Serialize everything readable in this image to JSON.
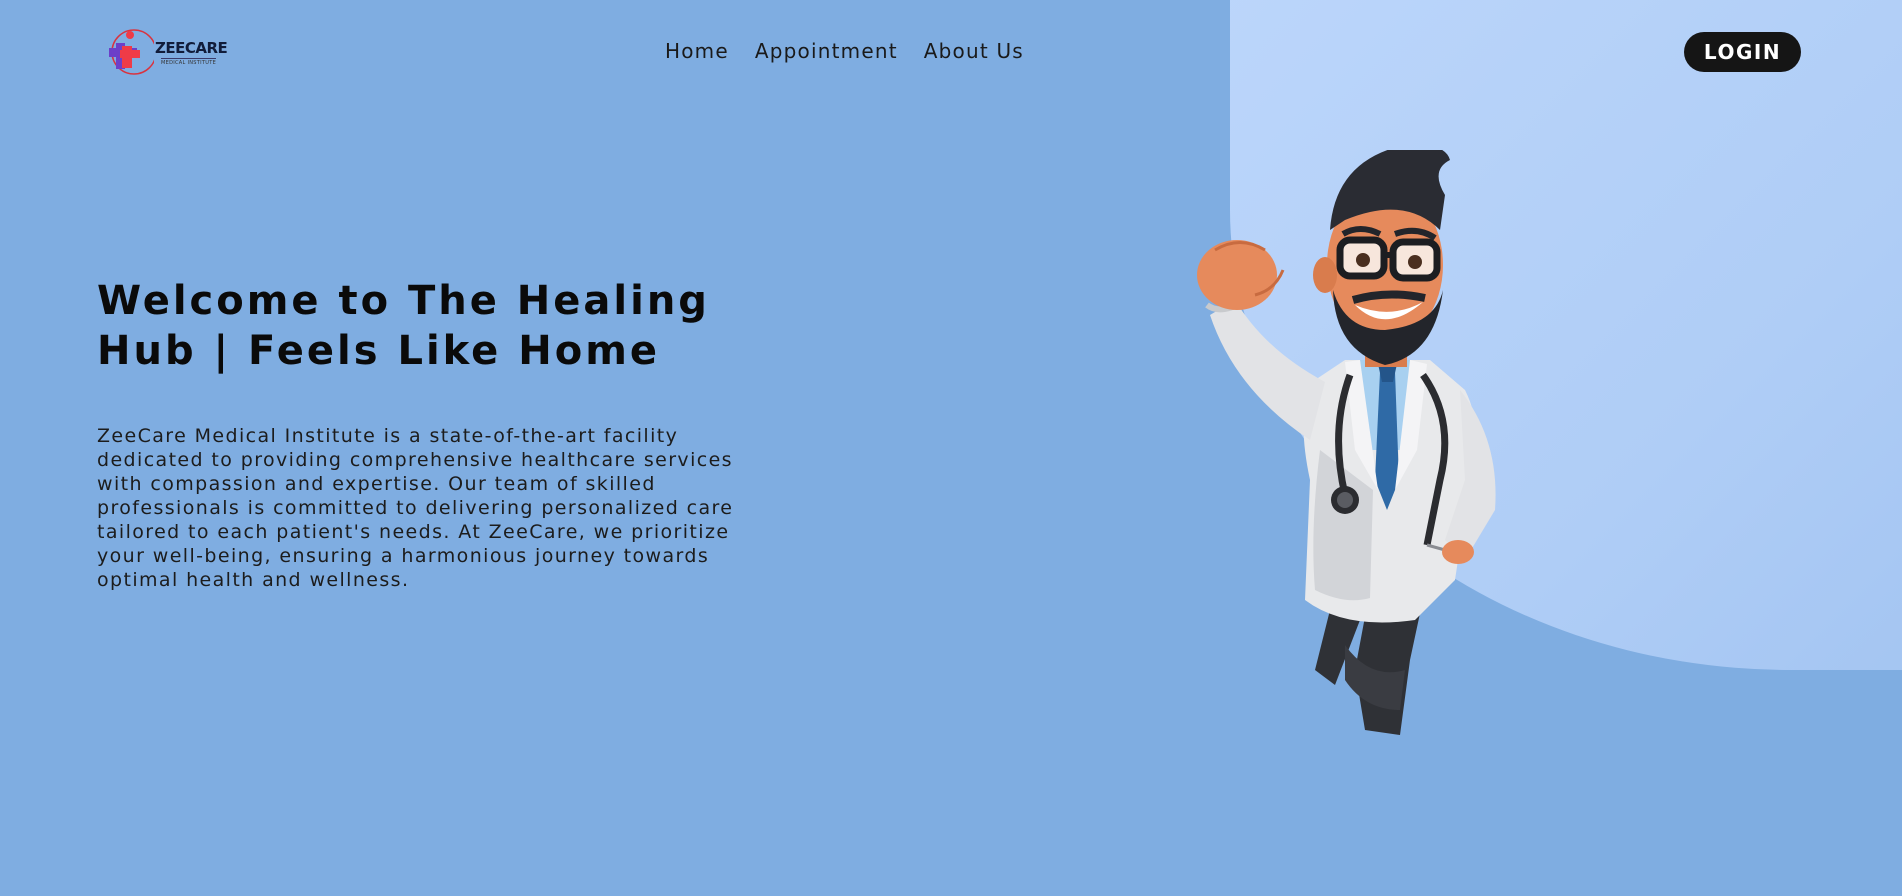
{
  "brand": {
    "name": "ZEECARE",
    "subtitle": "MEDICAL INSTITUTE"
  },
  "nav": {
    "links": [
      "Home",
      "Appointment",
      "About Us"
    ],
    "login_label": "LOGIN"
  },
  "hero": {
    "title": "Welcome to The Healing Hub | Feels Like Home",
    "description": "ZeeCare Medical Institute is a state-of-the-art facility dedicated to providing comprehensive healthcare services with compassion and expertise. Our team of skilled professionals is committed to delivering personalized care tailored to each patient's needs. At ZeeCare, we prioritize your well-being, ensuring a harmonious journey towards optimal health and wellness.",
    "illustration": "doctor-illustration"
  },
  "colors": {
    "background": "#7fade1",
    "blob": "#b9d4fa",
    "button": "#151515",
    "text": "#0a0a0a"
  }
}
